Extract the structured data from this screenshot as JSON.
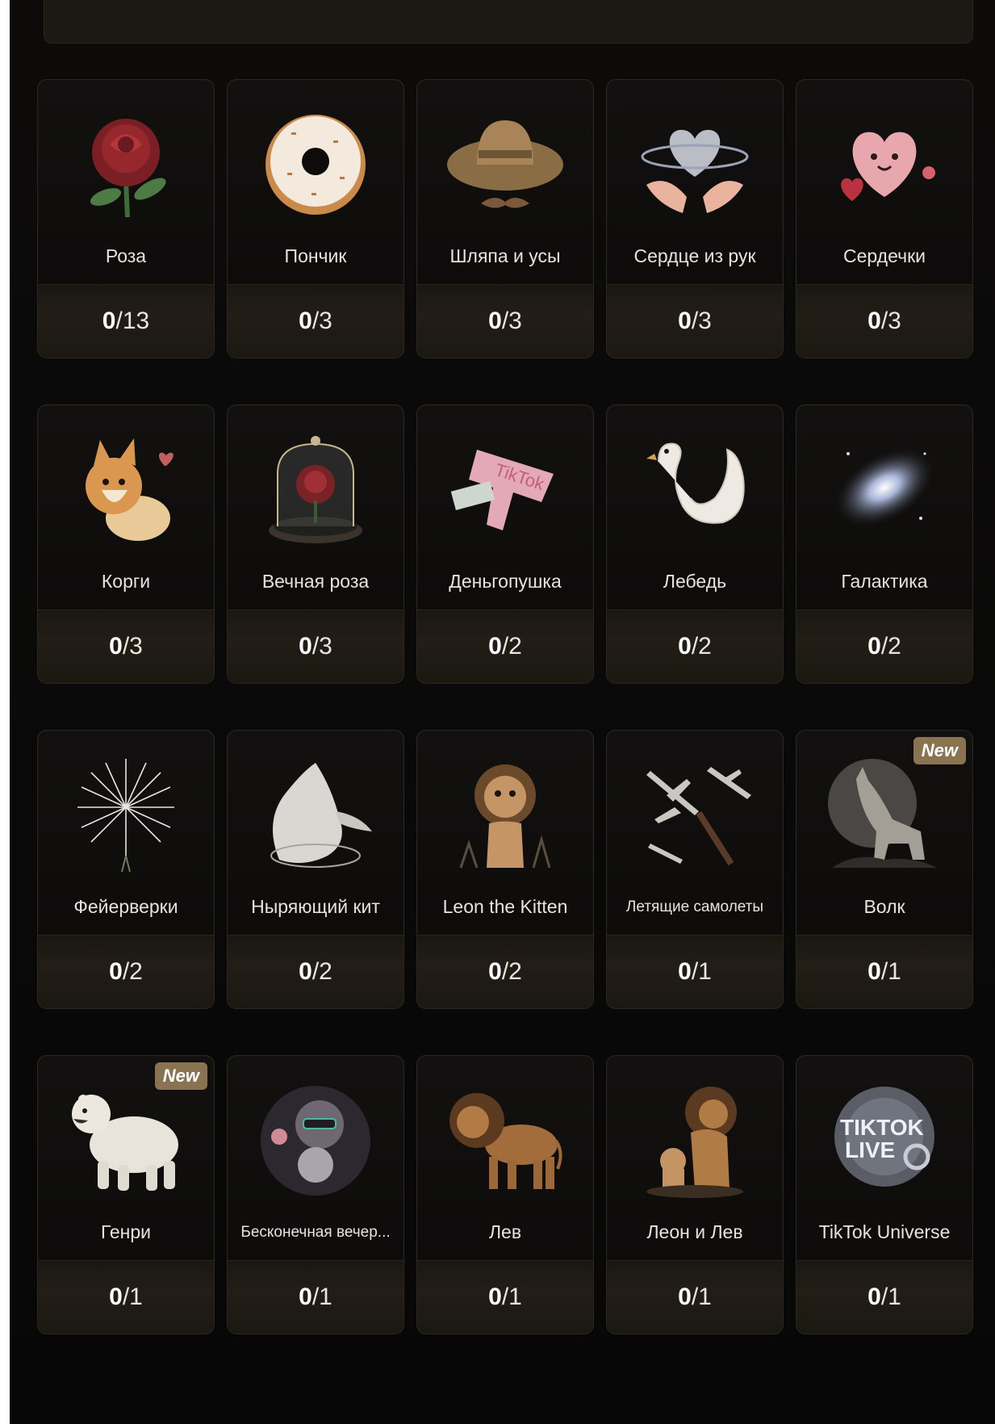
{
  "gifts": [
    {
      "name": "Роза",
      "current": "0",
      "total": "/13",
      "icon": "rose-icon"
    },
    {
      "name": "Пончик",
      "current": "0",
      "total": "/3",
      "icon": "donut-icon"
    },
    {
      "name": "Шляпа и усы",
      "current": "0",
      "total": "/3",
      "icon": "hat-mustache-icon"
    },
    {
      "name": "Сердце из рук",
      "current": "0",
      "total": "/3",
      "icon": "heart-hands-icon"
    },
    {
      "name": "Сердечки",
      "current": "0",
      "total": "/3",
      "icon": "hearts-icon"
    },
    {
      "name": "Корги",
      "current": "0",
      "total": "/3",
      "icon": "corgi-icon"
    },
    {
      "name": "Вечная роза",
      "current": "0",
      "total": "/3",
      "icon": "eternal-rose-icon"
    },
    {
      "name": "Деньгопушка",
      "current": "0",
      "total": "/2",
      "icon": "money-gun-icon"
    },
    {
      "name": "Лебедь",
      "current": "0",
      "total": "/2",
      "icon": "swan-icon"
    },
    {
      "name": "Галактика",
      "current": "0",
      "total": "/2",
      "icon": "galaxy-icon"
    },
    {
      "name": "Фейерверки",
      "current": "0",
      "total": "/2",
      "icon": "fireworks-icon"
    },
    {
      "name": "Ныряющий кит",
      "current": "0",
      "total": "/2",
      "icon": "whale-icon"
    },
    {
      "name": "Leon the Kitten",
      "current": "0",
      "total": "/2",
      "icon": "lion-kitten-icon"
    },
    {
      "name": "Летящие самолеты",
      "current": "0",
      "total": "/1",
      "icon": "planes-icon"
    },
    {
      "name": "Волк",
      "current": "0",
      "total": "/1",
      "icon": "wolf-icon",
      "badge": "New"
    },
    {
      "name": "Генри",
      "current": "0",
      "total": "/1",
      "icon": "polar-bear-icon",
      "badge": "New"
    },
    {
      "name": "Бесконечная вечер...",
      "current": "0",
      "total": "/1",
      "icon": "party-cat-icon"
    },
    {
      "name": "Лев",
      "current": "0",
      "total": "/1",
      "icon": "lion-icon"
    },
    {
      "name": "Леон и Лев",
      "current": "0",
      "total": "/1",
      "icon": "lion-cub-icon"
    },
    {
      "name": "TikTok Universe",
      "current": "0",
      "total": "/1",
      "icon": "tiktok-universe-icon"
    }
  ],
  "colors": {
    "background": "#0b0a09",
    "card": "#121110",
    "card_border": "#2c261e",
    "badge": "#8a7350",
    "text": "#e8e4dc"
  }
}
